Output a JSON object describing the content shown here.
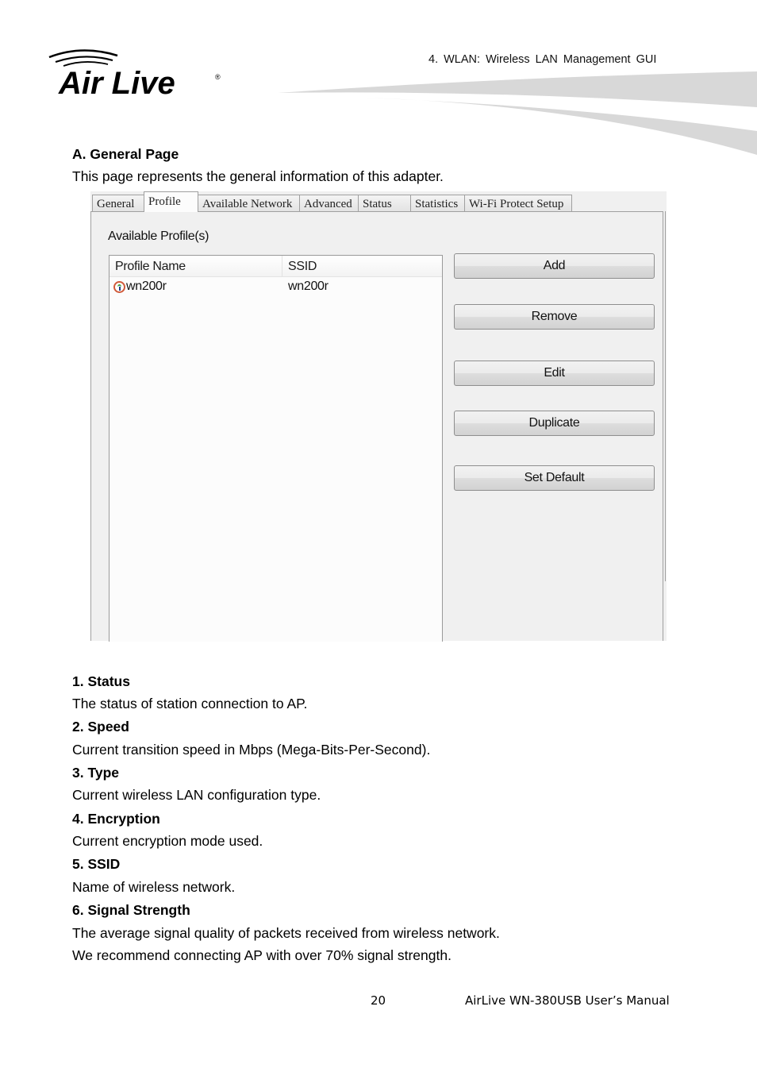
{
  "header": {
    "logo_text": "Air Live",
    "chapter": "4. WLAN: Wireless LAN Management GUI"
  },
  "section": {
    "title": "A. General Page",
    "intro": "This page represents the general information of this adapter."
  },
  "dialog": {
    "tabs": [
      {
        "label": "General",
        "active": false
      },
      {
        "label": "Profile",
        "active": true
      },
      {
        "label": "Available Network",
        "active": false
      },
      {
        "label": "Advanced",
        "active": false
      },
      {
        "label": "Status",
        "active": false
      },
      {
        "label": "Statistics",
        "active": false
      },
      {
        "label": "Wi-Fi Protect Setup",
        "active": false
      }
    ],
    "section_label": "Available Profile(s)",
    "list": {
      "columns": [
        "Profile Name",
        "SSID"
      ],
      "rows": [
        {
          "icon": "wireless-profile-icon",
          "profile_name": "wn200r",
          "ssid": "wn200r"
        }
      ]
    },
    "buttons": {
      "add": "Add",
      "remove": "Remove",
      "edit": "Edit",
      "duplicate": "Duplicate",
      "set_default": "Set Default"
    }
  },
  "items": [
    {
      "title": "1. Status",
      "desc": "The status of station connection to AP."
    },
    {
      "title": "2. Speed",
      "desc": "Current transition speed in Mbps (Mega-Bits-Per-Second)."
    },
    {
      "title": "3. Type",
      "desc": "Current wireless LAN configuration type."
    },
    {
      "title": "4. Encryption",
      "desc": "Current encryption mode used."
    },
    {
      "title": "5. SSID",
      "desc": "Name of wireless network."
    },
    {
      "title": "6. Signal Strength",
      "desc": "The average signal quality of packets received from wireless network.",
      "desc2": "We recommend connecting AP with over 70% signal strength."
    }
  ],
  "footer": {
    "page_number": "20",
    "manual_title": "AirLive WN-380USB User’s Manual"
  }
}
